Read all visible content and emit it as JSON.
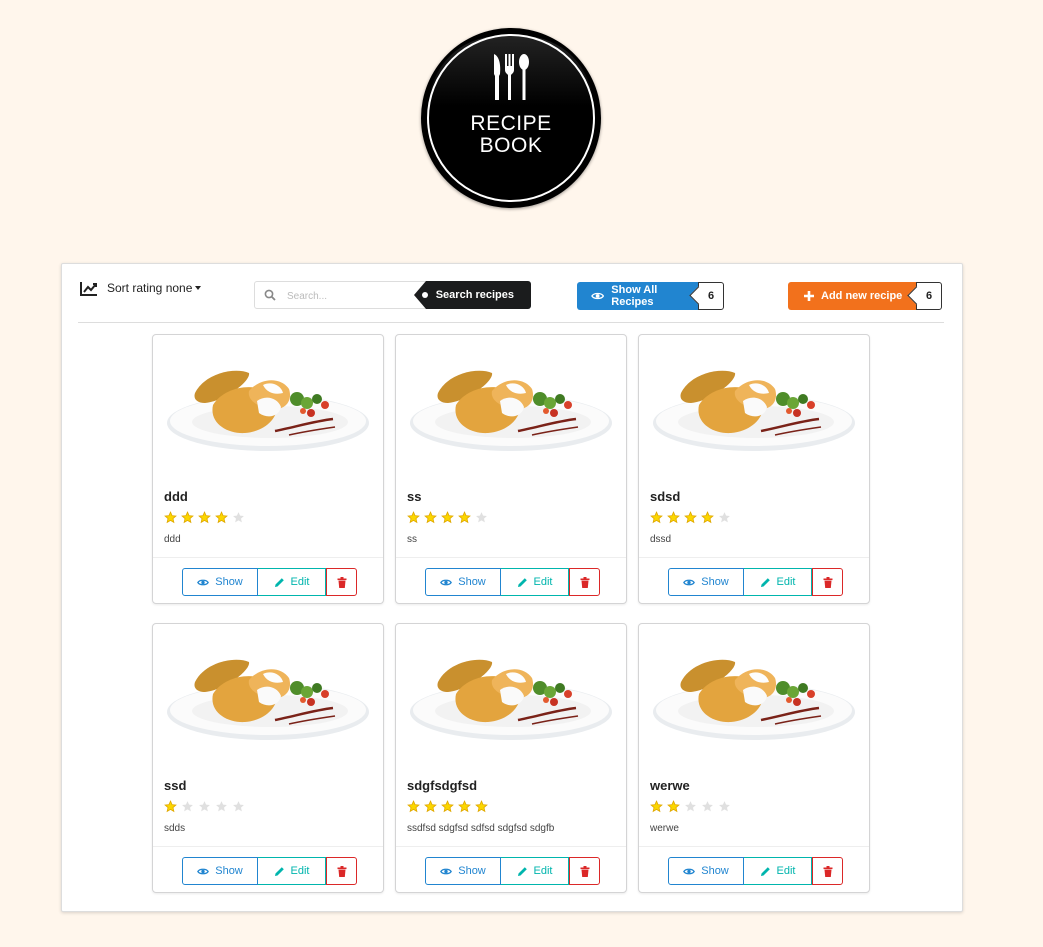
{
  "logo": {
    "line1": "RECIPE",
    "line2": "BOOK"
  },
  "toolbar": {
    "sort_label": "Sort rating none",
    "search_placeholder": "Search...",
    "search_tag": "Search recipes",
    "show_all_label": "Show All Recipes",
    "show_all_count": "6",
    "add_new_label": "Add new recipe",
    "add_new_count": "6"
  },
  "card_actions": {
    "show": "Show",
    "edit": "Edit"
  },
  "recipes": [
    {
      "title": "ddd",
      "rating": 4,
      "description": "ddd"
    },
    {
      "title": "ss",
      "rating": 4,
      "description": "ss"
    },
    {
      "title": "sdsd",
      "rating": 4,
      "description": "dssd"
    },
    {
      "title": "ssd",
      "rating": 1,
      "description": "sdds"
    },
    {
      "title": "sdgfsdgfsd",
      "rating": 5,
      "description": "ssdfsd sdgfsd sdfsd sdgfsd sdgfb"
    },
    {
      "title": "werwe",
      "rating": 2,
      "description": "werwe"
    }
  ],
  "colors": {
    "primary": "#2185d0",
    "orange": "#f2711c",
    "teal": "#00b5ad",
    "red": "#db2828",
    "star": "#fbd600"
  }
}
